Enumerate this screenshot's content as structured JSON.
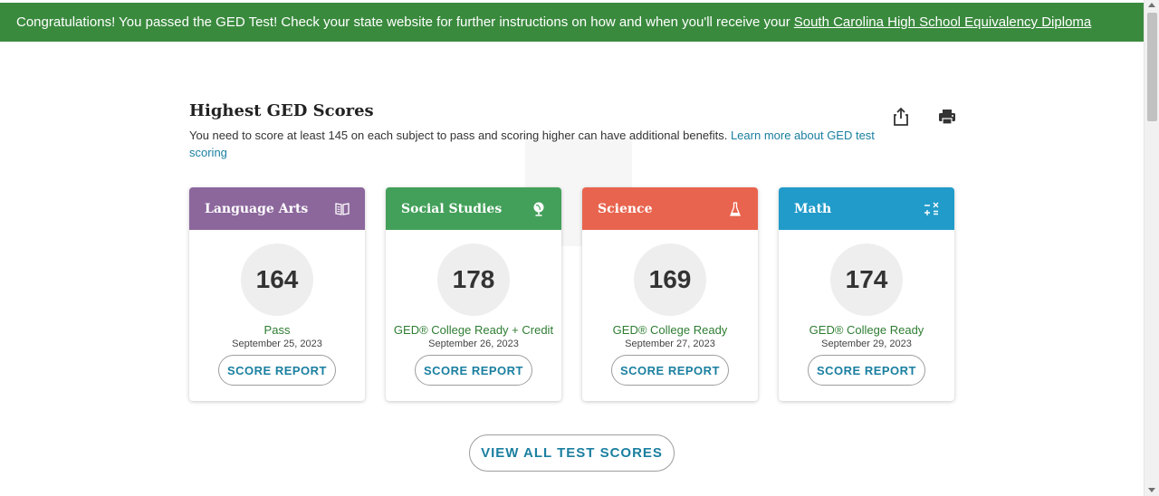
{
  "banner": {
    "text": "Congratulations! You passed the GED Test! Check your state website for further instructions on how and when you'll receive your",
    "link": "South Carolina High School Equivalency Diploma"
  },
  "section": {
    "title": "Highest GED Scores",
    "description": "You need to score at least 145 on each subject to pass and scoring higher can have additional benefits.",
    "learn_more": "Learn more about GED test scoring"
  },
  "actions": {
    "share_icon": "share-icon",
    "print_icon": "print-icon"
  },
  "cards": [
    {
      "subject": "Language Arts",
      "icon": "book-icon",
      "color": "#8c679c",
      "score": "164",
      "status": "Pass",
      "date": "September 25, 2023",
      "button": "SCORE REPORT"
    },
    {
      "subject": "Social Studies",
      "icon": "globe-icon",
      "color": "#43a05a",
      "score": "178",
      "status": "GED® College Ready + Credit",
      "date": "September 26, 2023",
      "button": "SCORE REPORT"
    },
    {
      "subject": "Science",
      "icon": "flask-icon",
      "color": "#e8644e",
      "score": "169",
      "status": "GED® College Ready",
      "date": "September 27, 2023",
      "button": "SCORE REPORT"
    },
    {
      "subject": "Math",
      "icon": "calculator-icon",
      "color": "#219bc9",
      "score": "174",
      "status": "GED® College Ready",
      "date": "September 29, 2023",
      "button": "SCORE REPORT"
    }
  ],
  "view_all": "VIEW ALL TEST SCORES"
}
